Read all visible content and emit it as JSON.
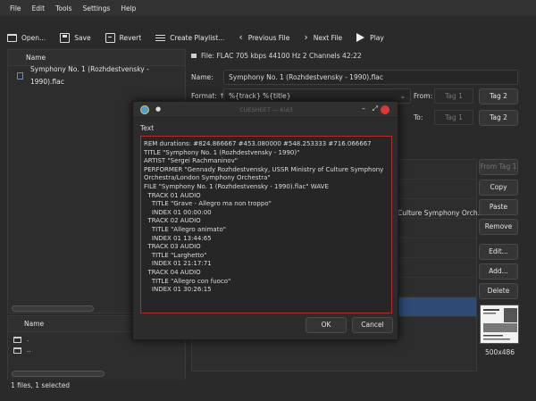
{
  "menu": [
    "File",
    "Edit",
    "Tools",
    "Settings",
    "Help"
  ],
  "toolbar": {
    "open": "Open...",
    "save": "Save",
    "revert": "Revert",
    "create_playlist": "Create Playlist...",
    "previous_file": "Previous File",
    "next_file": "Next File",
    "play": "Play"
  },
  "file_list": {
    "header": "Name",
    "items": [
      "Symphony No. 1 (Rozhdestvensky - 1990).flac"
    ]
  },
  "dir_list": {
    "header": "Name",
    "items": [
      ".",
      ".."
    ]
  },
  "file_info": "File: FLAC 705 kbps 44100 Hz 2 Channels 42:22",
  "name_label": "Name:",
  "name_value": "Symphony No. 1 (Rozhdestvensky - 1990).flac",
  "format_label": "Format: ↑",
  "format_value": "%{track} %{title}",
  "from_label": "From:",
  "to_label": "To:",
  "from_tag": "Tag 1",
  "to_tag": "Tag 1",
  "buttons": {
    "tag2_top": "Tag 2",
    "tag2_bottom": "Tag 2",
    "from_tag1": "From Tag 1",
    "copy": "Copy",
    "paste": "Paste",
    "remove": "Remove",
    "edit": "Edit...",
    "add": "Add...",
    "delete": "Delete"
  },
  "orchestra_snippet": "Culture Symphony Orch...",
  "cover_size": "500x486",
  "status": "1 files, 1 selected",
  "dialog": {
    "title": "CUESHEET — Kid3",
    "label": "Text",
    "lines": [
      "REM durations: #824.866667 #453.080000 #548.253333 #716.066667",
      "TITLE \"Symphony No. 1 (Rozhdestvensky - 1990)\"",
      "ARTIST \"Sergei Rachmaninov\"",
      "PERFORMER \"Gennady Rozhdestvensky, USSR Ministry of Culture Symphony",
      "Orchestra/London Symphony Orchestra\"",
      "FILE \"Symphony No. 1 (Rozhdestvensky - 1990).flac\" WAVE",
      "  TRACK 01 AUDIO",
      "    TITLE \"Grave - Allegro ma non troppo\"",
      "    INDEX 01 00:00:00",
      "  TRACK 02 AUDIO",
      "    TITLE \"Allegro animato\"",
      "    INDEX 01 13:44:65",
      "  TRACK 03 AUDIO",
      "    TITLE \"Larghetto\"",
      "    INDEX 01 21:17:71",
      "  TRACK 04 AUDIO",
      "    TITLE \"Allegro con fuoco\"",
      "    INDEX 01 30:26:15"
    ],
    "ok": "OK",
    "cancel": "Cancel"
  }
}
